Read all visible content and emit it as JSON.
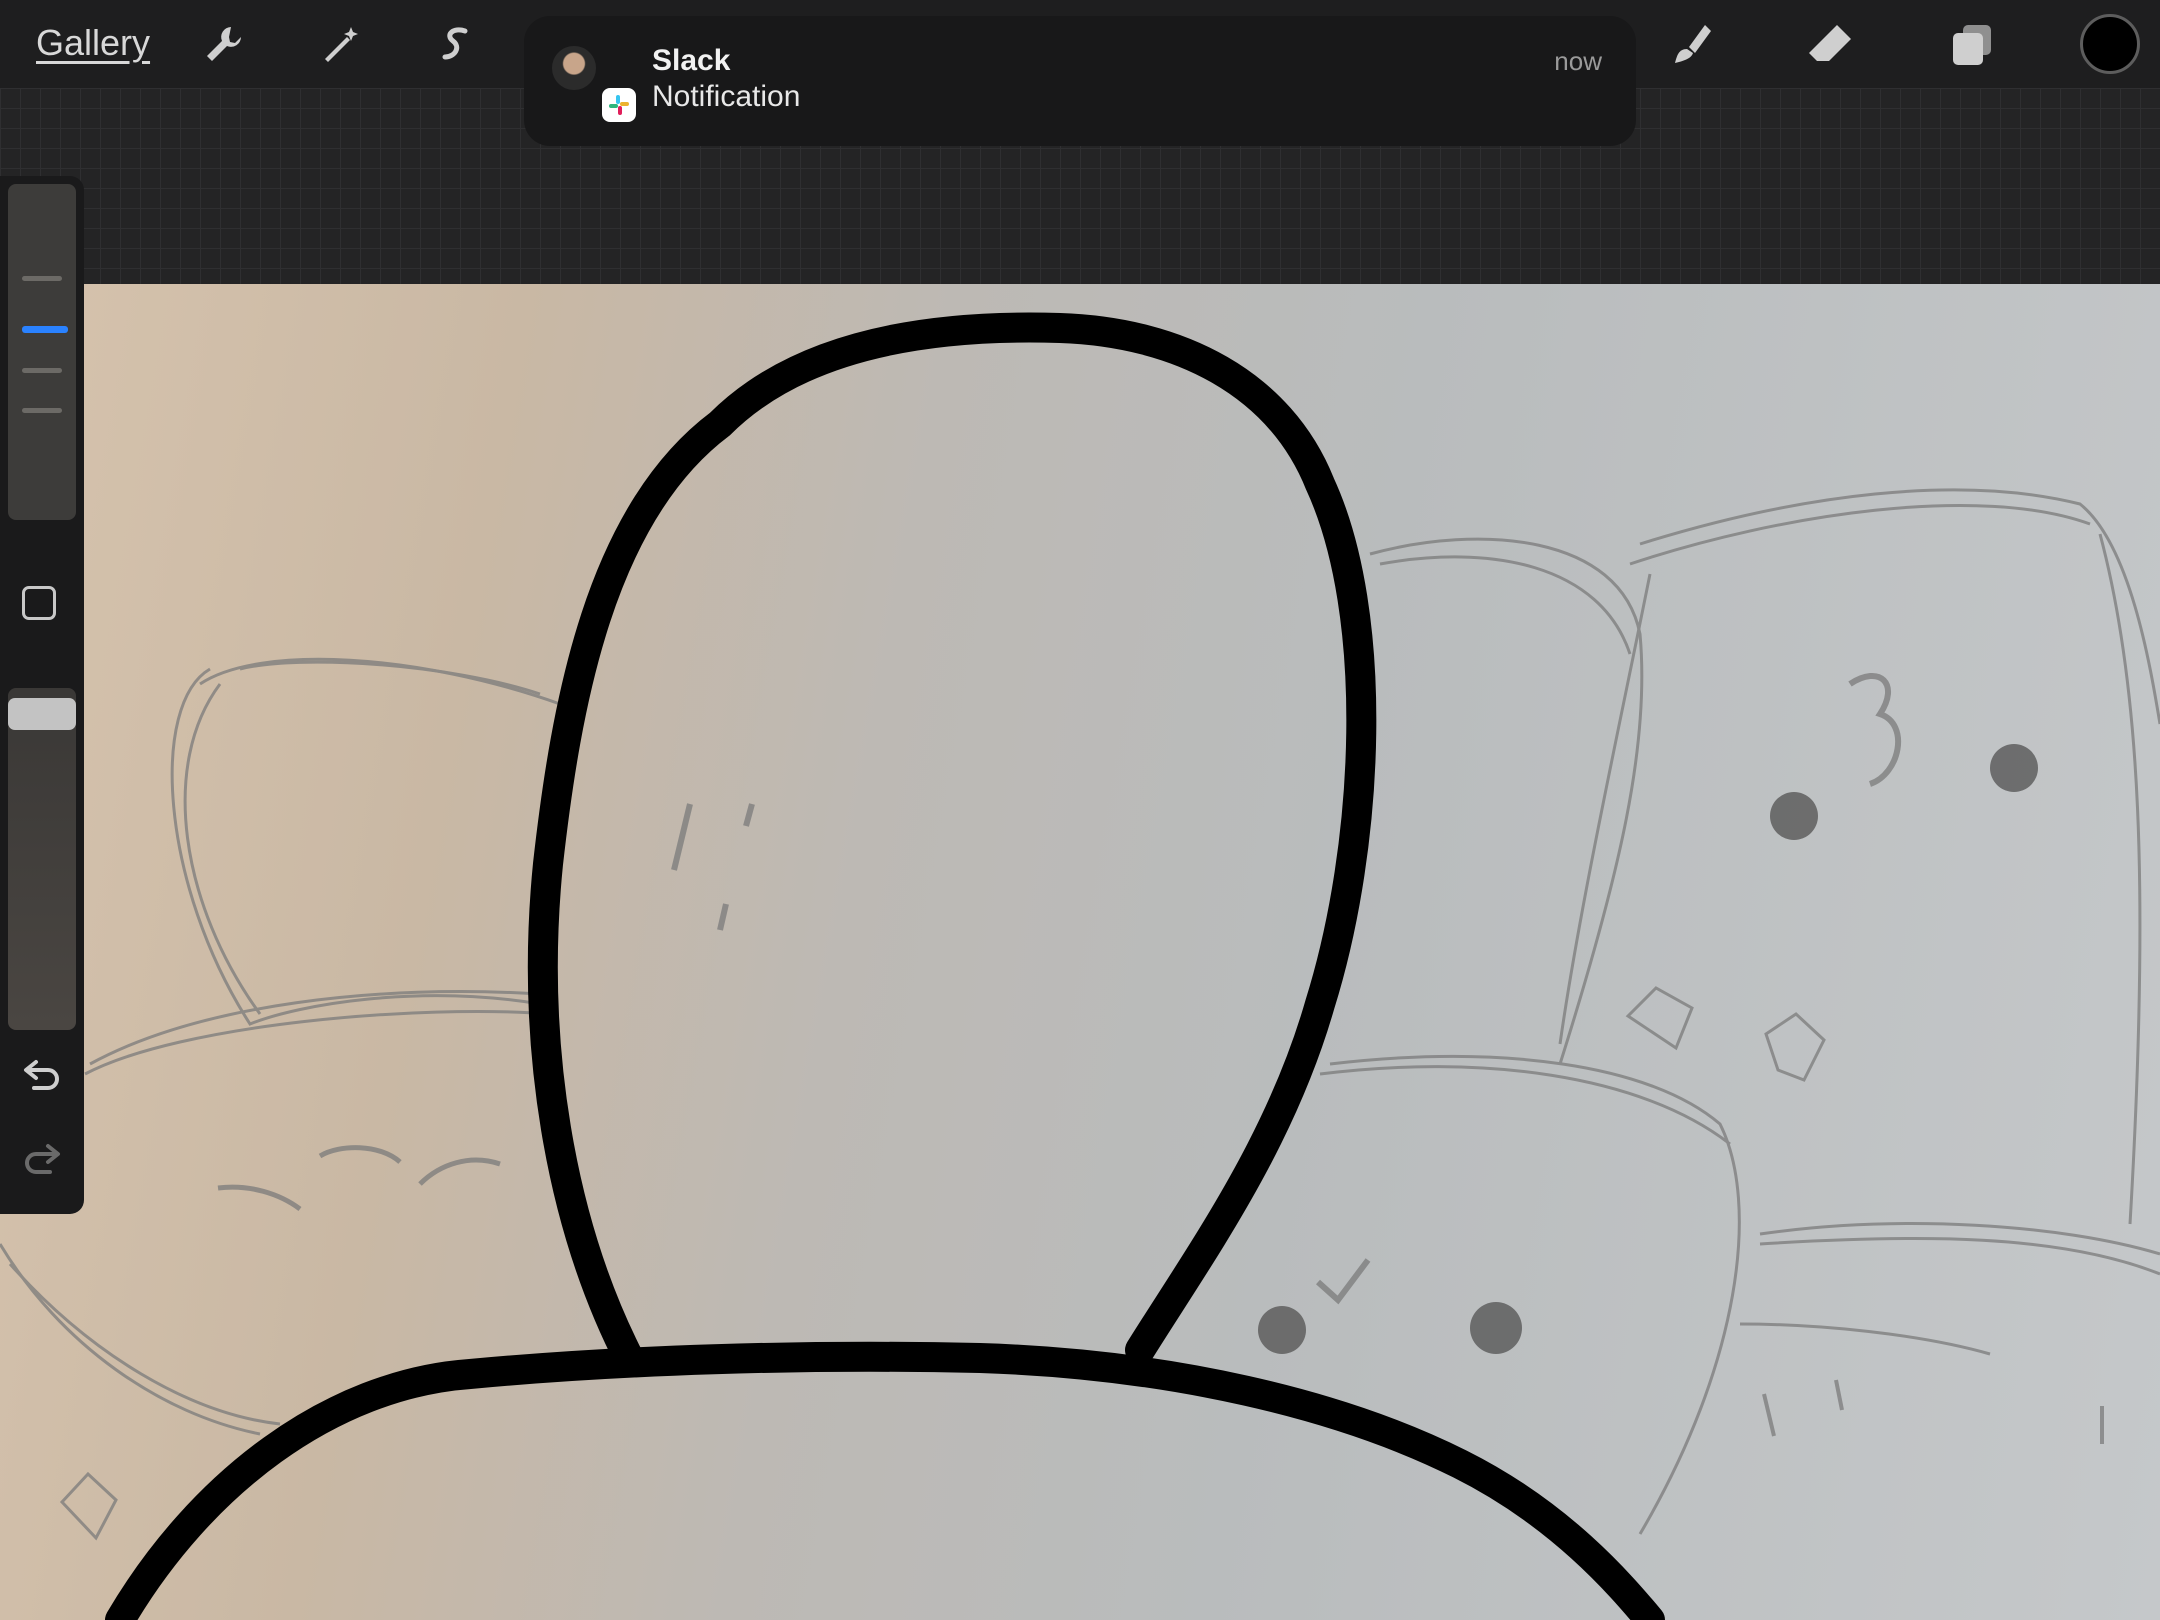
{
  "toolbar": {
    "gallery_label": "Gallery",
    "tools": [
      "wrench-icon",
      "magic-wand-icon",
      "selection-s-icon",
      "brush-icon",
      "smudge-icon",
      "eraser-icon",
      "layers-icon"
    ],
    "current_color": "#000000"
  },
  "notification": {
    "app": "Slack",
    "title": "Slack",
    "body": "Notification",
    "time": "now"
  },
  "sidebar": {
    "brush_size_selected_index": 1,
    "opacity_level": 1.0
  },
  "colors": {
    "toolbar_bg": "#1e1e1f",
    "accent": "#2a82ff",
    "ink": "#000000",
    "pencil": "#7a7a7a"
  }
}
